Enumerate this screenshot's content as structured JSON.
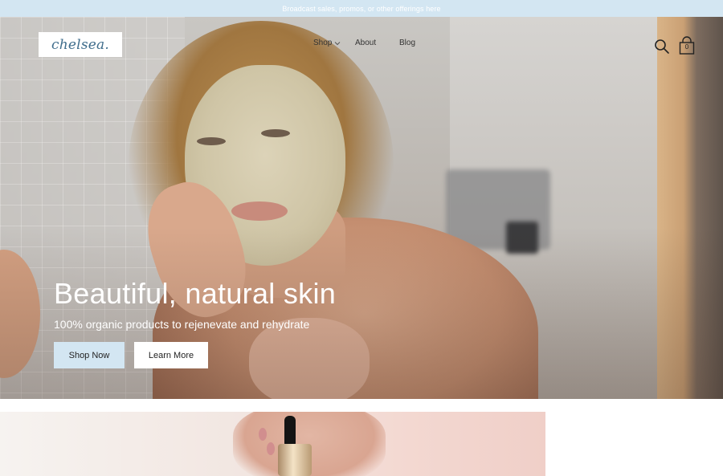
{
  "announcement": {
    "text": "Broadcast sales, promos, or other offerings here"
  },
  "header": {
    "logo_text": "chelsea.",
    "nav": [
      {
        "label": "Shop",
        "has_dropdown": true
      },
      {
        "label": "About"
      },
      {
        "label": "Blog"
      }
    ],
    "icons": {
      "search": "search-icon",
      "cart": "shopping-bag-icon"
    },
    "cart_count": "0"
  },
  "hero": {
    "title": "Beautiful, natural skin",
    "subtitle": "100% organic products to rejenevate and rehydrate",
    "primary_button": "Shop Now",
    "secondary_button": "Learn More"
  },
  "colors": {
    "announcement_bg": "#d3e6f2",
    "primary_button_bg": "#d3e6f2",
    "logo_text": "#3f6d8c"
  }
}
